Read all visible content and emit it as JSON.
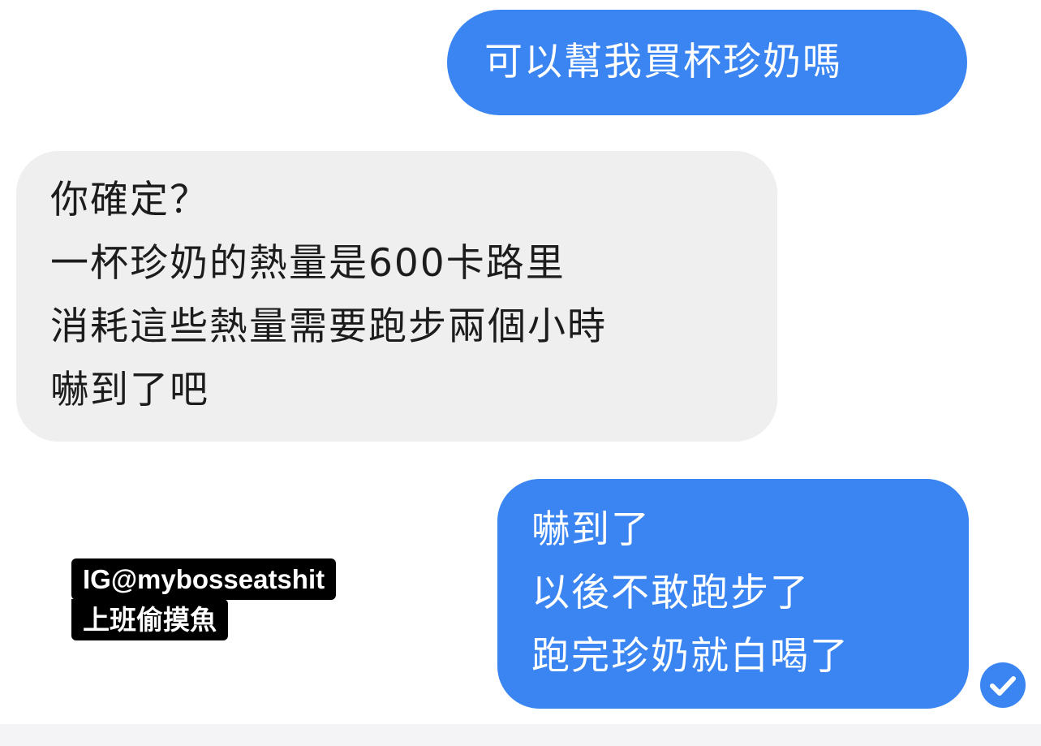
{
  "conversation": {
    "messages": [
      {
        "direction": "outgoing",
        "lines": [
          "可以幫我買杯珍奶嗎"
        ]
      },
      {
        "direction": "incoming",
        "lines": [
          "你確定？",
          "一杯珍奶的熱量是600卡路里",
          "消耗這些熱量需要跑步兩個小時",
          "嚇到了吧"
        ]
      },
      {
        "direction": "outgoing",
        "lines": [
          "嚇到了",
          "以後不敢跑步了",
          "跑完珍奶就白喝了"
        ]
      }
    ],
    "read_receipt_icon": "check-circle-icon"
  },
  "watermark": {
    "handle": "IG@mybosseatshit",
    "caption": "上班偷摸魚"
  },
  "colors": {
    "outgoing_bubble": "#3a85f2",
    "incoming_bubble": "#efefef",
    "read_receipt": "#3a85f2"
  }
}
